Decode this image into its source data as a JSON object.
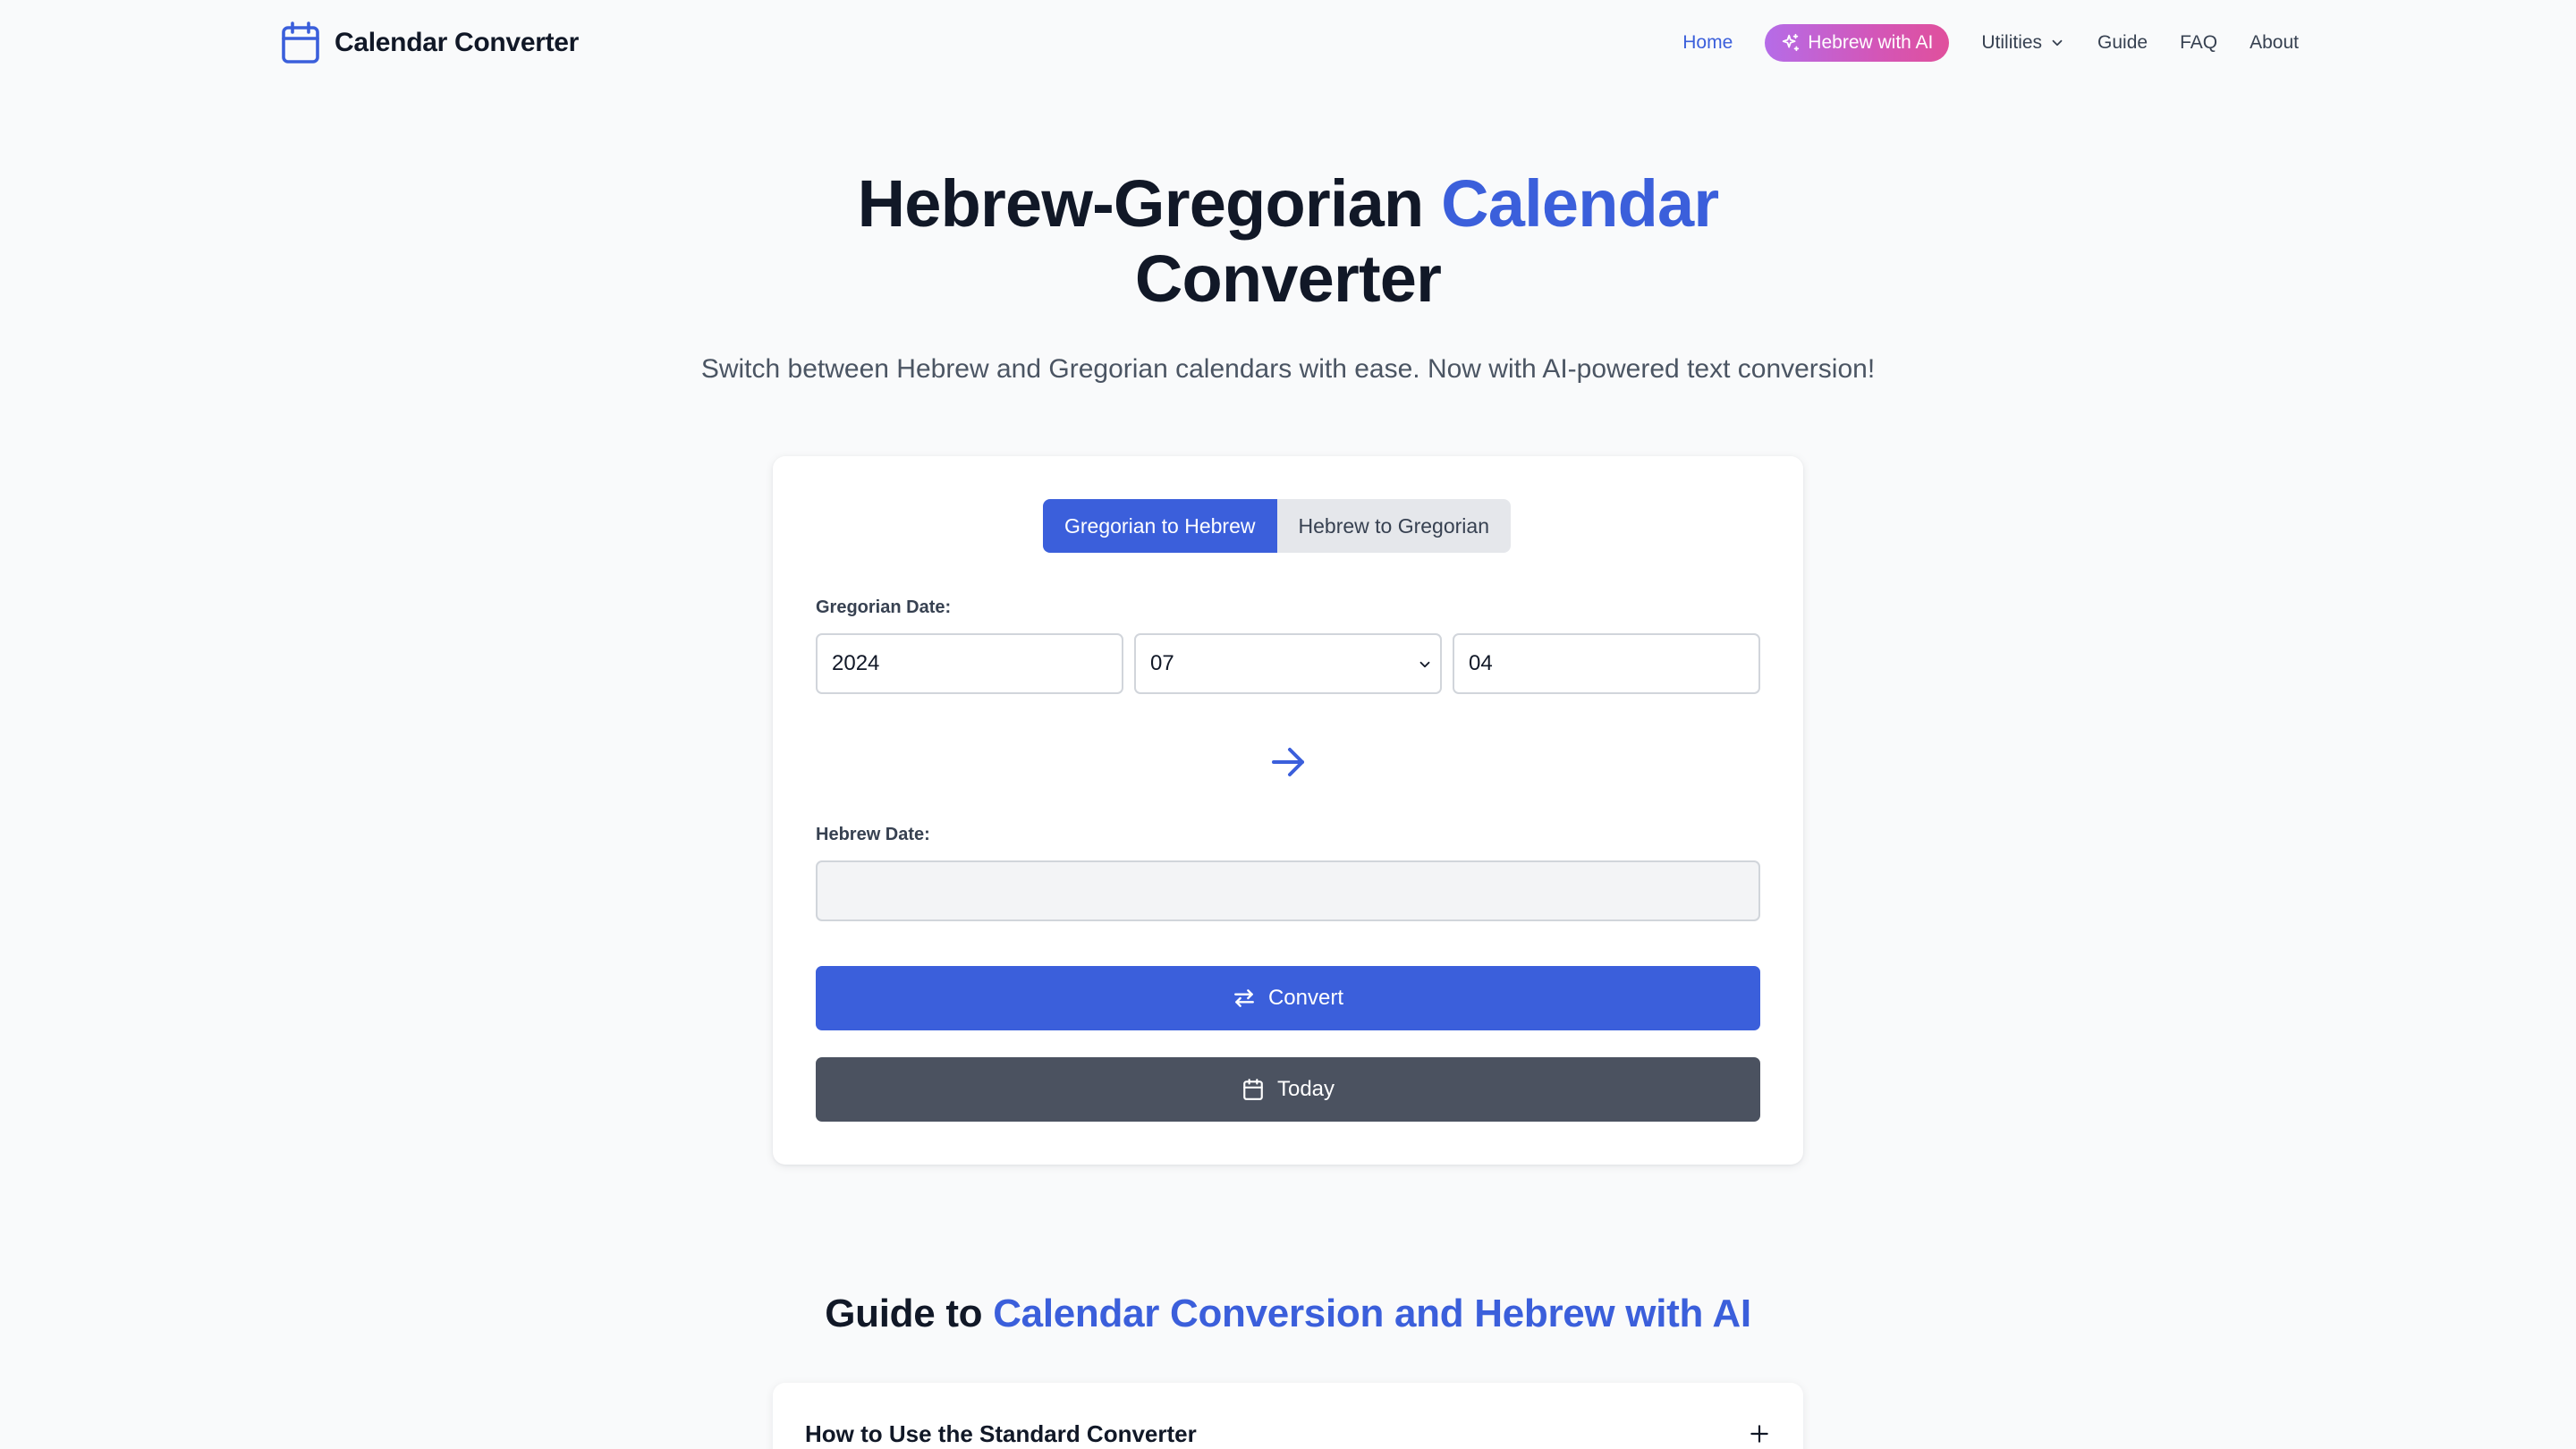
{
  "header": {
    "brand": "Calendar Converter",
    "brand_icon": "calendar-icon",
    "nav": {
      "home": "Home",
      "hebrew_ai": "Hebrew with AI",
      "utilities": "Utilities",
      "guide": "Guide",
      "faq": "FAQ",
      "about": "About"
    }
  },
  "hero": {
    "title_part1": "Hebrew-Gregorian ",
    "title_accent": "Calendar",
    "title_part2": "Converter",
    "subtitle": "Switch between Hebrew and Gregorian calendars with ease. Now with AI-powered text conversion!"
  },
  "converter": {
    "tabs": [
      "Gregorian to Hebrew",
      "Hebrew to Gregorian"
    ],
    "active_tab": "Gregorian to Hebrew",
    "gregorian_label": "Gregorian Date:",
    "year": "2024",
    "month": "07",
    "day": "04",
    "hebrew_label": "Hebrew Date:",
    "hebrew_value": "",
    "convert_label": "Convert",
    "today_label": "Today"
  },
  "guide": {
    "title_part1": "Guide to ",
    "title_accent": "Calendar Conversion and Hebrew with AI",
    "accordion_item": "How to Use the Standard Converter"
  },
  "colors": {
    "accent": "#3b5fdb",
    "dark_button": "#4b5260",
    "background": "#f9fafb"
  }
}
